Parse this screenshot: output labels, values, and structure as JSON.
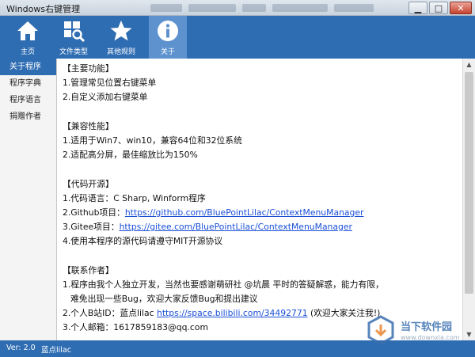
{
  "window": {
    "title": "Windows右键管理",
    "controls": {
      "minimize": "▁",
      "maximize": "□",
      "close": "✕"
    }
  },
  "toolbar": {
    "items": [
      {
        "label": "主页",
        "icon": "home-icon",
        "active": false
      },
      {
        "label": "文件类型",
        "icon": "file-type-icon",
        "active": false
      },
      {
        "label": "其他规则",
        "icon": "star-icon",
        "active": false
      },
      {
        "label": "关于",
        "icon": "info-icon",
        "active": true
      }
    ]
  },
  "sidebar": {
    "items": [
      {
        "label": "关于程序",
        "active": true
      },
      {
        "label": "程序字典",
        "active": false
      },
      {
        "label": "程序语言",
        "active": false
      },
      {
        "label": "捐赠作者",
        "active": false
      }
    ]
  },
  "content": {
    "lines": [
      "【主要功能】",
      "1.管理常见位置右键菜单",
      "2.自定义添加右键菜单",
      "",
      "【兼容性能】",
      "1.适用于Win7、win10，兼容64位和32位系统",
      "2.适配高分屏，最佳缩放比为150%",
      "",
      "【代码开源】",
      {
        "prefix": "1.代码语言：C Sharp, Winform程序"
      },
      {
        "prefix": "2.Github项目：",
        "link": "https://github.com/BluePointLilac/ContextMenuManager"
      },
      {
        "prefix": "3.Gitee项目：",
        "link": "https://gitee.com/BluePointLilac/ContextMenuManager"
      },
      "4.使用本程序的源代码请遵守MIT开源协议",
      "",
      "【联系作者】",
      "1.程序由我个人独立开发，当然也要感谢萌研社 @坑晨 平时的答疑解惑，能力有限，",
      {
        "indent": true,
        "prefix": "难免出现一些Bug，欢迎大家反馈Bug和提出建议"
      },
      {
        "prefix": "2.个人B站ID：蓝点lilac  ",
        "link": "https://space.bilibili.com/34492771",
        "suffix": " (欢迎大家关注我!)"
      },
      "3.个人邮箱：1617859183@qq.com"
    ]
  },
  "statusbar": {
    "version": "Ver: 2.0",
    "author": "蓝点lilac"
  },
  "watermark": {
    "name": "当下软件园",
    "url": "www.downxia.com"
  },
  "colors": {
    "accent": "#2f6db3",
    "accent_light": "#5d92cf",
    "link": "#1a4fd6"
  }
}
